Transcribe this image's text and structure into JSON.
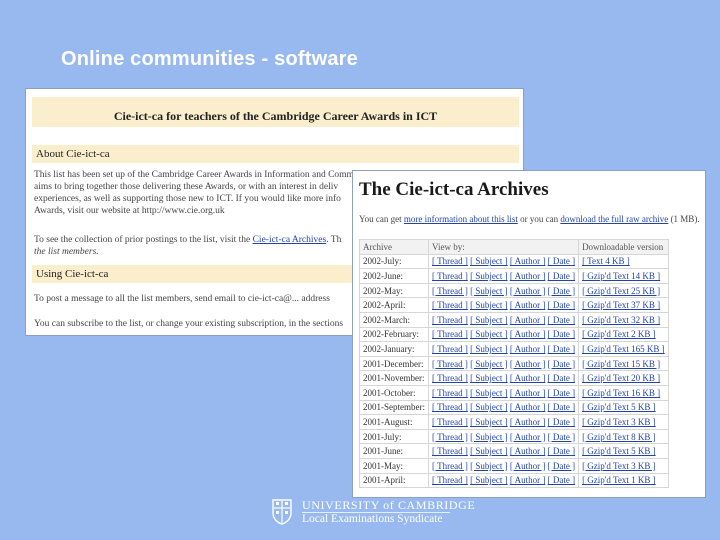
{
  "slide": {
    "title": "Online communities - software"
  },
  "back_page": {
    "header": "Cie-ict-ca    for teachers of the Cambridge Career Awards in ICT",
    "sections": [
      {
        "heading": "About Cie-ict-ca"
      },
      {
        "heading": "Using Cie-ict-ca"
      }
    ],
    "about_lines": [
      "This list has been set up of the Cambridge Career Awards in Information and Communication Technology (ICT). It",
      "aims to bring together those delivering these Awards, or with an interest in deliv",
      "experiences, as well as supporting those new to ICT. If you would like more info",
      "Awards, visit our website at http://www.cie.org.uk"
    ],
    "archive_line_prefix": "To see the collection of prior postings to the list, visit the",
    "archive_link": "Cie-ict-ca Archives",
    "archive_line_suffix": ". Th",
    "archive_line2": "the list members.",
    "using_lines": [
      "To post a message to all the list members, send email to cie-ict-ca@... address",
      "You can subscribe to the list, or change your existing subscription, in the sections"
    ]
  },
  "front_page": {
    "title": "The Cie-ict-ca Archives",
    "subtitle_prefix": "You can get",
    "subtitle_link1": "more information about this list",
    "subtitle_mid": "or you can",
    "subtitle_link2": "download the full raw archive",
    "subtitle_suffix": "(1 MB).",
    "table": {
      "headers": [
        "Archive",
        "View by:",
        "Downloadable version"
      ],
      "view_links": [
        "[ Thread ]",
        "[ Subject ]",
        "[ Author ]",
        "[ Date ]"
      ],
      "rows": [
        {
          "archive": "2002-July:",
          "download": "[ Text 4 KB ]"
        },
        {
          "archive": "2002-June:",
          "download": "[ Gzip'd Text 14 KB ]"
        },
        {
          "archive": "2002-May:",
          "download": "[ Gzip'd Text 25 KB ]"
        },
        {
          "archive": "2002-April:",
          "download": "[ Gzip'd Text 37 KB ]"
        },
        {
          "archive": "2002-March:",
          "download": "[ Gzip'd Text 32 KB ]"
        },
        {
          "archive": "2002-February:",
          "download": "[ Gzip'd Text 2 KB ]"
        },
        {
          "archive": "2002-January:",
          "download": "[ Gzip'd Text 165 KB ]"
        },
        {
          "archive": "2001-December:",
          "download": "[ Gzip'd Text 15 KB ]"
        },
        {
          "archive": "2001-November:",
          "download": "[ Gzip'd Text 20 KB ]"
        },
        {
          "archive": "2001-October:",
          "download": "[ Gzip'd Text 16 KB ]"
        },
        {
          "archive": "2001-September:",
          "download": "[ Gzip'd Text 5 KB ]"
        },
        {
          "archive": "2001-August:",
          "download": "[ Gzip'd Text 3 KB ]"
        },
        {
          "archive": "2001-July:",
          "download": "[ Gzip'd Text 8 KB ]"
        },
        {
          "archive": "2001-June:",
          "download": "[ Gzip'd Text 5 KB ]"
        },
        {
          "archive": "2001-May:",
          "download": "[ Gzip'd Text 3 KB ]"
        },
        {
          "archive": "2001-April:",
          "download": "[ Gzip'd Text 1 KB ]"
        }
      ]
    }
  },
  "footer": {
    "logo_line1": "UNIVERSITY of CAMBRIDGE",
    "logo_line2": "Local Examinations Syndicate",
    "crest_icon": "university-crest-icon"
  },
  "colors": {
    "slide_background": "#97b9ef",
    "band_background": "#fbeecd",
    "link": "#2244aa"
  }
}
